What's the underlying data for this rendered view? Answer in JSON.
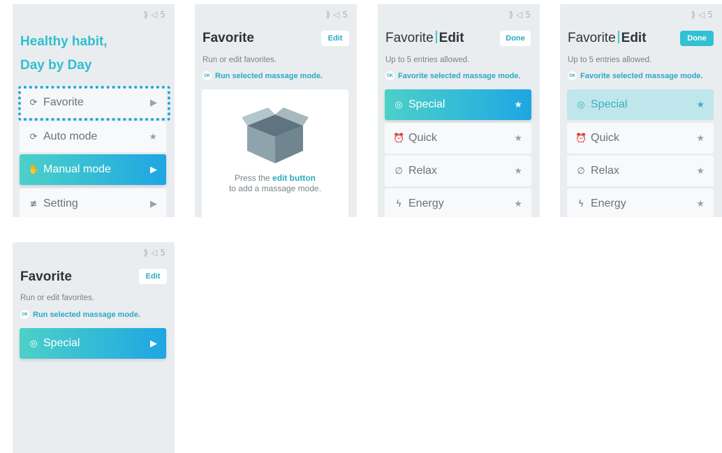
{
  "status": {
    "icon1": "ringtone-icon",
    "icon2": "volume-icon",
    "volume": "5"
  },
  "screen1": {
    "hero_line1": "Healthy habit,",
    "hero_line2": "Day by Day",
    "menu": [
      {
        "label": "Favorite",
        "icon": "favorite-icon",
        "trailing": "▶"
      },
      {
        "label": "Auto mode",
        "icon": "auto-icon",
        "trailing": "★"
      },
      {
        "label": "Manual mode",
        "icon": "hand-icon",
        "trailing": "▶"
      },
      {
        "label": "Setting",
        "icon": "sliders-icon",
        "trailing": "▶"
      }
    ]
  },
  "screen2": {
    "title": "Favorite",
    "edit_label": "Edit",
    "subtitle": "Run or edit favorites.",
    "ok_badge": "OK",
    "ok_text": "Run selected massage mode.",
    "empty_pre": "Press the ",
    "empty_link": "edit button",
    "empty_line2": "to add a massage mode."
  },
  "screen3": {
    "title_a": "Favorite",
    "title_b": "Edit",
    "done_label": "Done",
    "subtitle": "Up to 5 entries allowed.",
    "ok_badge": "OK",
    "ok_text": "Favorite selected massage mode.",
    "items": [
      {
        "label": "Special",
        "icon": "check-circle-icon",
        "trailing": "★"
      },
      {
        "label": "Quick",
        "icon": "alarm-icon",
        "trailing": "★"
      },
      {
        "label": "Relax",
        "icon": "leaf-icon",
        "trailing": "★"
      },
      {
        "label": "Energy",
        "icon": "bolt-icon",
        "trailing": "★"
      }
    ]
  },
  "screen4": {
    "title_a": "Favorite",
    "title_b": "Edit",
    "done_label": "Done",
    "subtitle": "Up to 5 entries allowed.",
    "ok_badge": "OK",
    "ok_text": "Favorite selected massage mode.",
    "items": [
      {
        "label": "Special",
        "icon": "check-circle-icon",
        "trailing": "★"
      },
      {
        "label": "Quick",
        "icon": "alarm-icon",
        "trailing": "★"
      },
      {
        "label": "Relax",
        "icon": "leaf-icon",
        "trailing": "★"
      },
      {
        "label": "Energy",
        "icon": "bolt-icon",
        "trailing": "★"
      }
    ]
  },
  "screen5": {
    "title": "Favorite",
    "edit_label": "Edit",
    "subtitle": "Run or edit favorites.",
    "ok_badge": "OK",
    "ok_text": "Run selected massage mode.",
    "items": [
      {
        "label": "Special",
        "icon": "check-circle-icon",
        "trailing": "▶"
      }
    ]
  },
  "colors": {
    "accent": "#31c1d2",
    "gradient_start": "#4cd1c8",
    "gradient_end": "#1ea6e3",
    "screen_bg": "#eaedf0"
  }
}
